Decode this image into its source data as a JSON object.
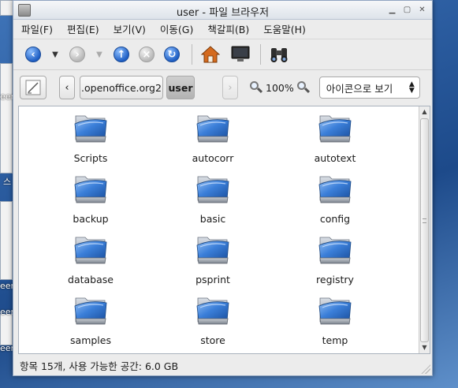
{
  "window": {
    "title": "user - 파일 브라우저"
  },
  "menu": [
    {
      "label": "파일(F)"
    },
    {
      "label": "편집(E)"
    },
    {
      "label": "보기(V)"
    },
    {
      "label": "이동(G)"
    },
    {
      "label": "책갈피(B)"
    },
    {
      "label": "도움말(H)"
    }
  ],
  "location": {
    "breadcrumbs": [
      ".openoffice.org2",
      "user"
    ],
    "zoom": "100%",
    "view_mode": "아이콘으로 보기"
  },
  "folders": [
    {
      "name": "Scripts"
    },
    {
      "name": "autocorr"
    },
    {
      "name": "autotext"
    },
    {
      "name": "backup"
    },
    {
      "name": "basic"
    },
    {
      "name": "config"
    },
    {
      "name": "database"
    },
    {
      "name": "psprint"
    },
    {
      "name": "registry"
    },
    {
      "name": "samples"
    },
    {
      "name": "store"
    },
    {
      "name": "temp"
    }
  ],
  "status": {
    "text": "항목 15개, 사용 가능한 공간: 6.0 GB"
  },
  "desktop": {
    "labels": [
      "een",
      "een",
      "een",
      "een",
      "스"
    ]
  },
  "colors": {
    "folder_blue": "#3b7fd9",
    "desktop_blue": "#2a5b9e"
  }
}
